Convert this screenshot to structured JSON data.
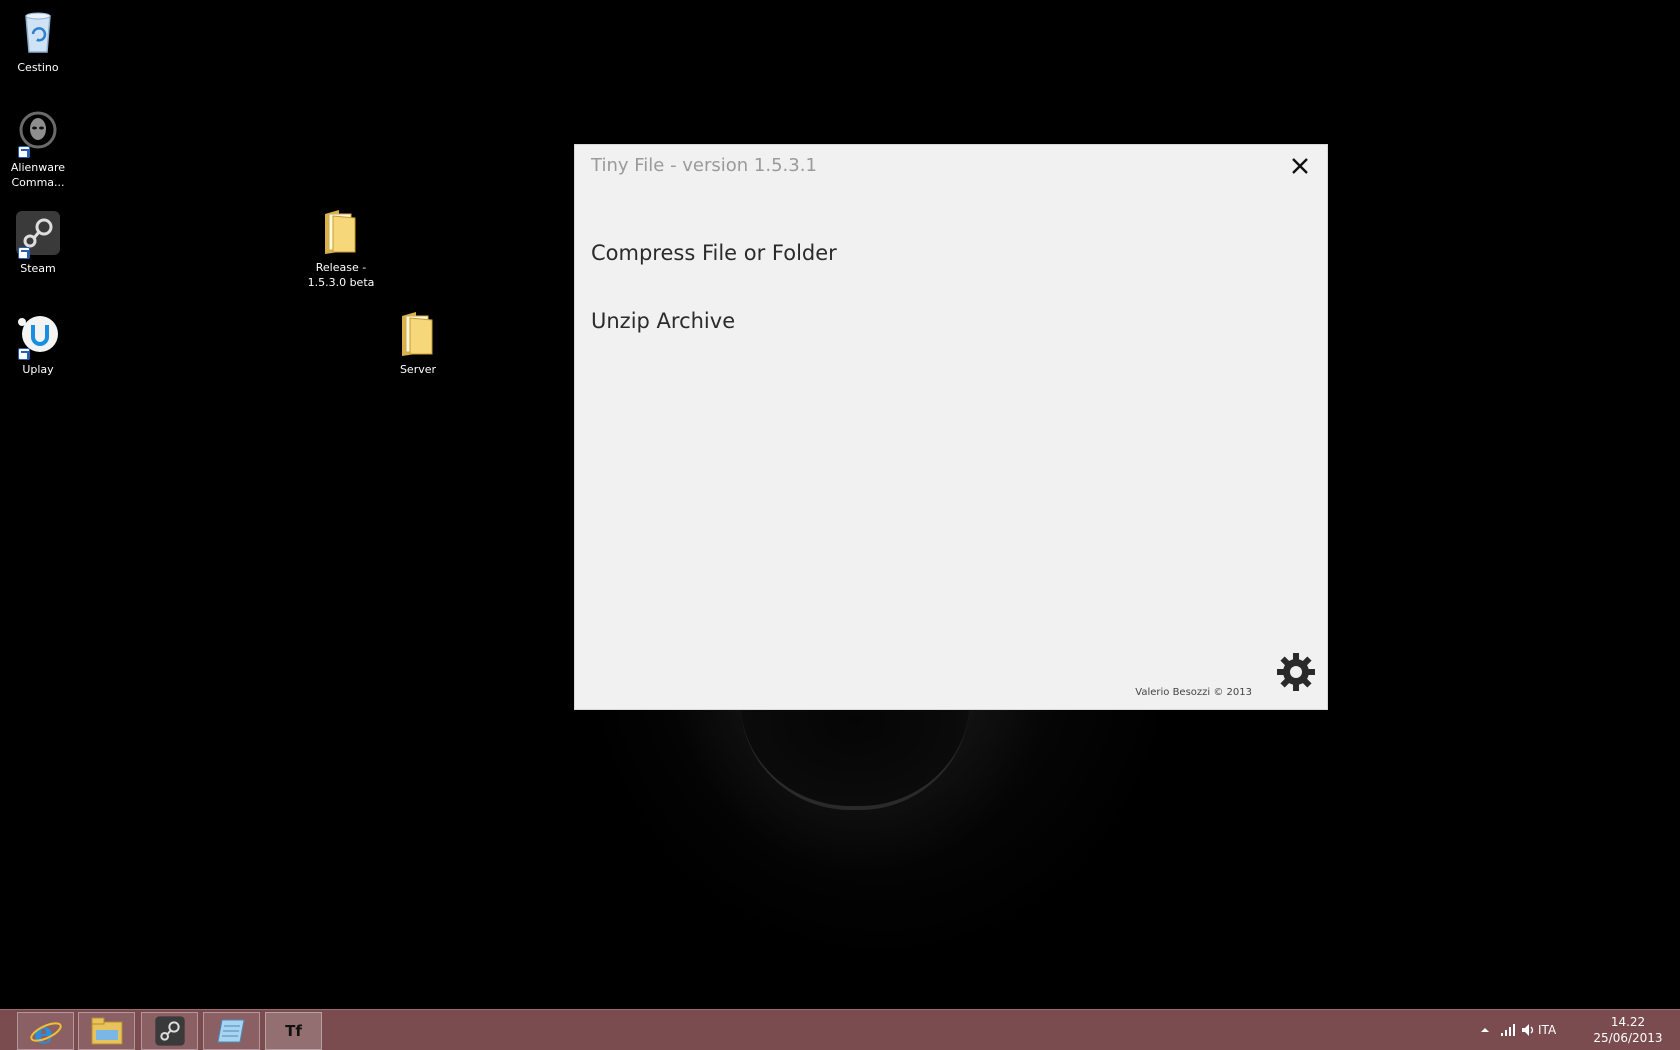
{
  "desktop": {
    "icons": [
      {
        "label": "Cestino",
        "icon": "recycle-bin-icon"
      },
      {
        "label": "Alienware Comma...",
        "icon": "alienware-command-icon"
      },
      {
        "label": "Steam",
        "icon": "steam-icon"
      },
      {
        "label": "Uplay",
        "icon": "uplay-icon"
      },
      {
        "label": "Release - 1.5.3.0 beta",
        "icon": "folder-icon"
      },
      {
        "label": "Server",
        "icon": "folder-icon"
      }
    ]
  },
  "app": {
    "title": "Tiny File - version 1.5.3.1",
    "menu": {
      "compress": "Compress File or Folder",
      "unzip": "Unzip Archive"
    },
    "copyright": "Valerio Besozzi © 2013",
    "close_icon": "close-icon",
    "settings_icon": "gear-icon"
  },
  "taskbar": {
    "pinned": [
      {
        "name": "Internet Explorer",
        "icon": "internet-explorer-icon"
      },
      {
        "name": "File Explorer",
        "icon": "file-explorer-icon"
      },
      {
        "name": "Steam",
        "icon": "steam-icon"
      },
      {
        "name": "Notepad",
        "icon": "notepad-icon"
      },
      {
        "name": "Tiny File",
        "icon": "tiny-file-icon",
        "label": "Tf"
      }
    ],
    "tray": {
      "language": "ITA",
      "time": "14.22",
      "date": "25/06/2013"
    }
  },
  "colors": {
    "taskbar": "#7a4b4f",
    "window_bg": "#f1f1f1",
    "title_text": "#9a9a9a"
  }
}
